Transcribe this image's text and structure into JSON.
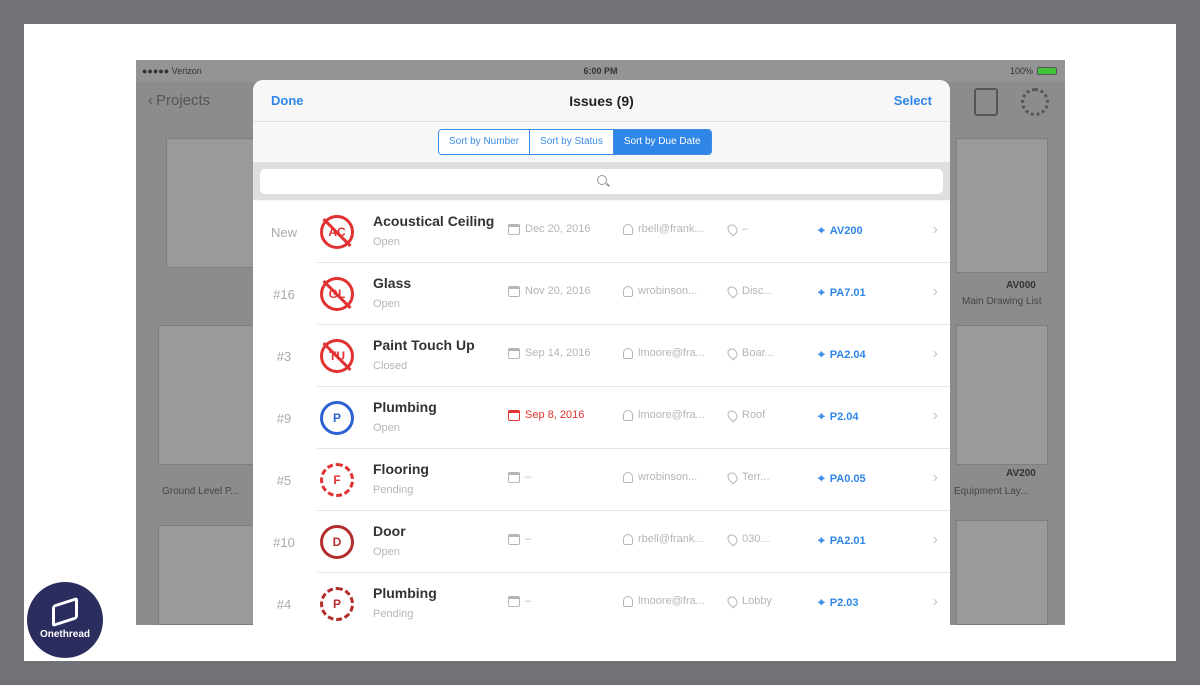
{
  "status_bar": {
    "carrier": "●●●●● Verizon ",
    "time": "6:00 PM",
    "battery": "100%"
  },
  "nav": {
    "back_label": "Projects"
  },
  "background_labels": [
    "AV000",
    "Main Drawing List",
    "AV200",
    "Equipment Lay...",
    "Ground Level P..."
  ],
  "modal": {
    "done": "Done",
    "title": "Issues (9)",
    "select": "Select",
    "sort_options": [
      "Sort by Number",
      "Sort by Status",
      "Sort by Due Date"
    ],
    "active_sort": "Sort by Due Date"
  },
  "issues": [
    {
      "number": "New",
      "badge": "AC",
      "title": "Acoustical Ceiling",
      "status": "Open",
      "date": "Dec 20, 2016",
      "assignee": "rbell@frank...",
      "location": "–",
      "sheet": "AV200"
    },
    {
      "number": "#16",
      "badge": "GL",
      "title": "Glass",
      "status": "Open",
      "date": "Nov 20, 2016",
      "assignee": "wrobinson...",
      "location": "Disc...",
      "sheet": "PA7.01"
    },
    {
      "number": "#3",
      "badge": "TU",
      "title": "Paint Touch Up",
      "status": "Closed",
      "date": "Sep 14, 2016",
      "assignee": "lmoore@fra...",
      "location": "Boar...",
      "sheet": "PA2.04"
    },
    {
      "number": "#9",
      "badge": "P",
      "title": "Plumbing",
      "status": "Open",
      "date": "Sep 8, 2016",
      "assignee": "lmoore@fra...",
      "location": "Roof",
      "sheet": "P2.04"
    },
    {
      "number": "#5",
      "badge": "F",
      "title": "Flooring",
      "status": "Pending",
      "date": "–",
      "assignee": "wrobinson...",
      "location": "Terr...",
      "sheet": "PA0.05"
    },
    {
      "number": "#10",
      "badge": "D",
      "title": "Door",
      "status": "Open",
      "date": "–",
      "assignee": "rbell@frank...",
      "location": "030...",
      "sheet": "PA2.01"
    },
    {
      "number": "#4",
      "badge": "P",
      "title": "Plumbing",
      "status": "Pending",
      "date": "–",
      "assignee": "lmoore@fra...",
      "location": "Lobby",
      "sheet": "P2.03"
    }
  ],
  "logo": {
    "text": "Onethread"
  },
  "colors": {
    "accent": "#2f86e6",
    "danger": "#e23131",
    "blue_badge": "#2d62d3",
    "brown_badge": "#b32d2d"
  }
}
